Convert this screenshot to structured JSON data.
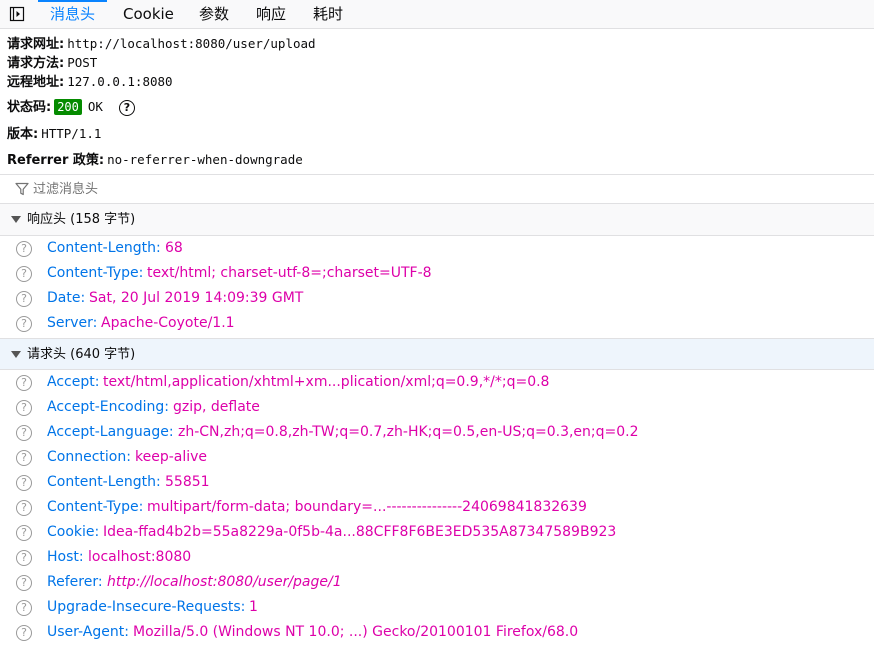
{
  "tabs": [
    {
      "label": "消息头",
      "selected": true
    },
    {
      "label": "Cookie",
      "selected": false
    },
    {
      "label": "参数",
      "selected": false
    },
    {
      "label": "响应",
      "selected": false
    },
    {
      "label": "耗时",
      "selected": false
    }
  ],
  "summary": {
    "url_label": "请求网址:",
    "url_value": "http://localhost:8080/user/upload",
    "method_label": "请求方法:",
    "method_value": "POST",
    "remote_label": "远程地址:",
    "remote_value": "127.0.0.1:8080",
    "status_label": "状态码:",
    "status_code": "200",
    "status_text": "OK",
    "status_color": "#058b00",
    "version_label": "版本:",
    "version_value": "HTTP/1.1",
    "referrer_label": "Referrer 政策:",
    "referrer_value": "no-referrer-when-downgrade"
  },
  "filter": {
    "placeholder": "过滤消息头"
  },
  "response_headers": {
    "title": "响应头 (158 字节)",
    "rows": [
      {
        "name": "Content-Length",
        "value": "68"
      },
      {
        "name": "Content-Type",
        "value": "text/html; charset-utf-8=;charset=UTF-8"
      },
      {
        "name": "Date",
        "value": "Sat, 20 Jul 2019 14:09:39 GMT"
      },
      {
        "name": "Server",
        "value": "Apache-Coyote/1.1"
      }
    ]
  },
  "request_headers": {
    "title": "请求头 (640 字节)",
    "rows": [
      {
        "name": "Accept",
        "value": "text/html,application/xhtml+xm...plication/xml;q=0.9,*/*;q=0.8"
      },
      {
        "name": "Accept-Encoding",
        "value": "gzip, deflate"
      },
      {
        "name": "Accept-Language",
        "value": "zh-CN,zh;q=0.8,zh-TW;q=0.7,zh-HK;q=0.5,en-US;q=0.3,en;q=0.2"
      },
      {
        "name": "Connection",
        "value": "keep-alive"
      },
      {
        "name": "Content-Length",
        "value": "55851"
      },
      {
        "name": "Content-Type",
        "value": "multipart/form-data; boundary=...---------------24069841832639"
      },
      {
        "name": "Cookie",
        "value": "Idea-ffad4b2b=55a8229a-0f5b-4a...88CFF8F6BE3ED535A87347589B923"
      },
      {
        "name": "Host",
        "value": "localhost:8080"
      },
      {
        "name": "Referer",
        "value": "http://localhost:8080/user/page/1",
        "italic": true
      },
      {
        "name": "Upgrade-Insecure-Requests",
        "value": "1"
      },
      {
        "name": "User-Agent",
        "value": "Mozilla/5.0 (Windows NT 10.0; ...) Gecko/20100101 Firefox/68.0"
      }
    ]
  },
  "colors": {
    "accent": "#0a84ff",
    "header_name": "#0074e8",
    "header_value": "#dd00a9"
  }
}
